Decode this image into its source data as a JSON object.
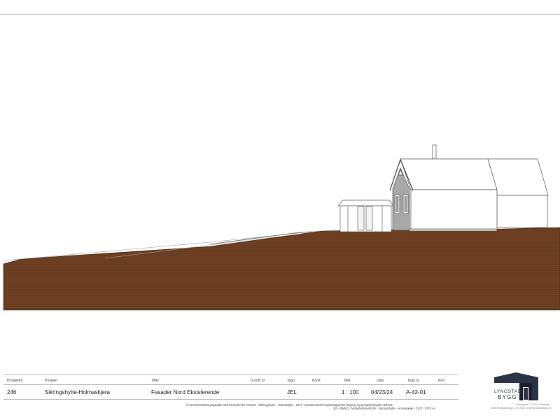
{
  "title_block": {
    "headers": {
      "project_no": "Prosjektnr.",
      "project": "Prosjekt",
      "title": "Tittel",
      "gnr_bnr": "G.nr/B.nr",
      "drawn": "Tegn.",
      "checked": "Kontr.",
      "scale": "Mål",
      "date": "Dato",
      "drawing_no": "Tegn.nr.",
      "revision": "Rev"
    },
    "values": {
      "project_no": "246",
      "project": "Sikringshytte-Holmaskjera",
      "title": "Fasader Nord Eksisterende",
      "drawn": "JEL",
      "scale": "1 : 100",
      "date": "04/23/24",
      "drawing_no": "A-42-01"
    },
    "file_path_line1": "C:\\Users\\JonErikLyngstad\\LYNGSTAD BYGG AS\\246 - Sikringshytte - Holmaskjær - OUT - Dokumenter\\Prosjektmappe\\02 Tegning og prosjektering\\03 ARK\\02",
    "file_path_line2": "3D - BIM\\01 - Modeller\\Revit\\246 - Sikringshytte - Holmaskjær - OUT - SITE.rvt"
  },
  "logo": {
    "line1": "LYNGSTAD",
    "line2": "BYGG",
    "address_line1": "Kransgata 17, 6217 Geiranger",
    "address_line2": "www.lyngstadbygg.no | E-post: post@lyngstadbygg.no"
  },
  "colors": {
    "terrain": "#6e4023",
    "terrain_stripe": "#5e361d",
    "outline": "#555555",
    "gable_wall": "#a8a8a8",
    "logo_dark": "#2b3446"
  }
}
